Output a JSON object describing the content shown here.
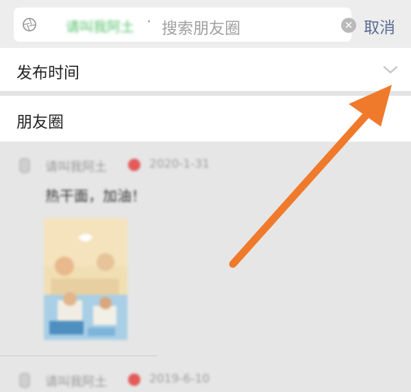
{
  "search": {
    "filter_tag": "请叫我阿土",
    "separator": "·",
    "placeholder": "搜索朋友圈",
    "clear_icon": "clear-circle-icon",
    "cancel_label": "取消"
  },
  "filter": {
    "publish_time_label": "发布时间",
    "chevron_icon": "chevron-down-icon"
  },
  "category": {
    "label": "朋友圈"
  },
  "feed": {
    "posts": [
      {
        "user": "请叫我阿土",
        "date": "2020-1-31",
        "text": "热干面，加油！"
      },
      {
        "user": "请叫我阿土",
        "date": "2019-6-10"
      }
    ]
  },
  "colors": {
    "accent": "#576b95",
    "annotation_arrow": "#f07a2c",
    "tag_green": "#56c26b"
  }
}
